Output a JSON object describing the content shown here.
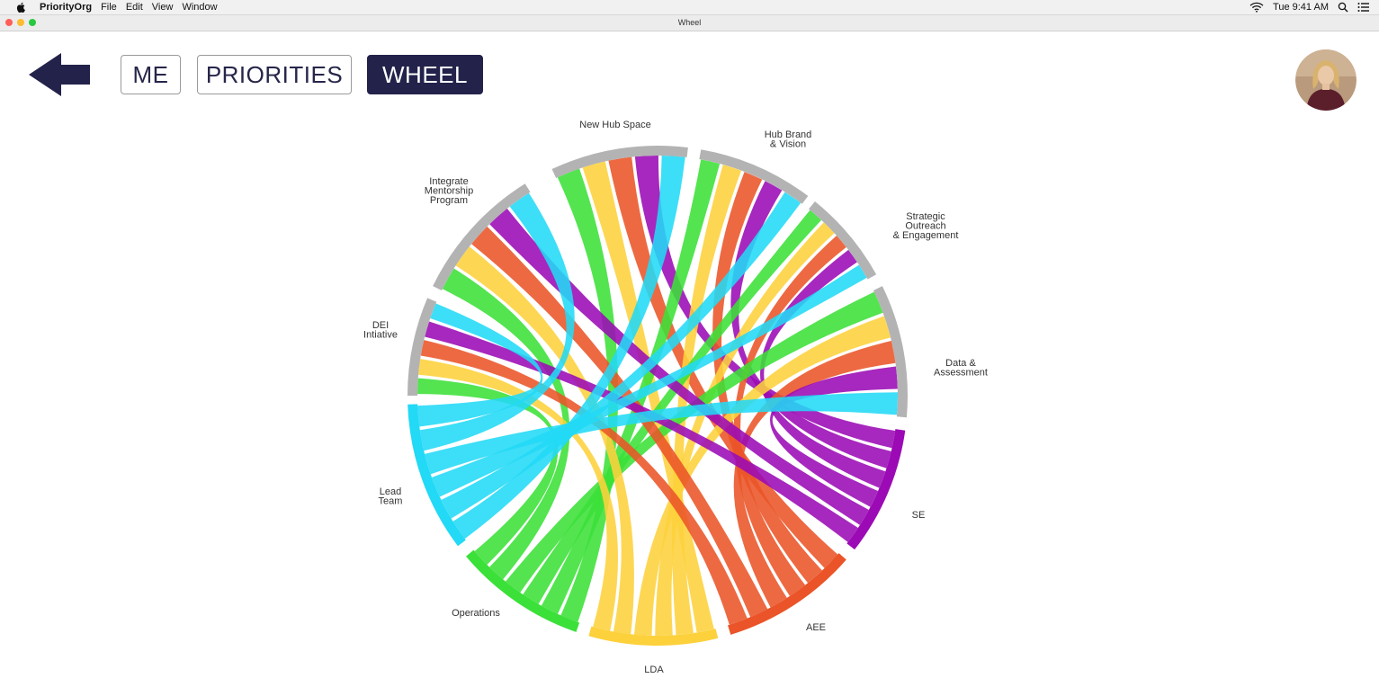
{
  "menubar": {
    "app_name": "PriorityOrg",
    "menus": [
      "File",
      "Edit",
      "View",
      "Window"
    ],
    "clock": "Tue 9:41 AM",
    "icons": [
      "apple-icon",
      "wifi-icon",
      "search-icon",
      "list-icon"
    ]
  },
  "window": {
    "title": "Wheel",
    "traffic_light_colors": [
      "#ff5f57",
      "#febc2e",
      "#28c840"
    ]
  },
  "nav": {
    "back_icon": "back-arrow-icon",
    "tabs": [
      {
        "label": "ME",
        "active": false
      },
      {
        "label": "PRIORITIES",
        "active": false
      },
      {
        "label": "WHEEL",
        "active": true
      }
    ]
  },
  "colors": {
    "accent": "#22224a",
    "arc_gray": "#b3b3b3",
    "cyan": "#22d9f6",
    "green": "#3be038",
    "yellow": "#fdd13b",
    "orange": "#ea5428",
    "purple": "#9b0ab5"
  },
  "wheel": {
    "groups": [
      {
        "id": "new_hub_space",
        "label_lines": [
          "New Hub Space"
        ],
        "color": "arc_gray"
      },
      {
        "id": "hub_brand",
        "label_lines": [
          "Hub Brand",
          "& Vision"
        ],
        "color": "arc_gray"
      },
      {
        "id": "strategic",
        "label_lines": [
          "Strategic",
          "Outreach",
          "& Engagement"
        ],
        "color": "arc_gray"
      },
      {
        "id": "data",
        "label_lines": [
          "Data &",
          "Assessment"
        ],
        "color": "arc_gray"
      },
      {
        "id": "se",
        "label_lines": [
          "SE"
        ],
        "color": "purple"
      },
      {
        "id": "aee",
        "label_lines": [
          "AEE"
        ],
        "color": "orange"
      },
      {
        "id": "lda",
        "label_lines": [
          "LDA"
        ],
        "color": "yellow"
      },
      {
        "id": "operations",
        "label_lines": [
          "Operations"
        ],
        "color": "green"
      },
      {
        "id": "lead_team",
        "label_lines": [
          "Lead",
          "Team"
        ],
        "color": "cyan"
      },
      {
        "id": "dei",
        "label_lines": [
          "DEI",
          "Intiative"
        ],
        "color": "arc_gray"
      },
      {
        "id": "mentorship",
        "label_lines": [
          "Integrate",
          "Mentorship",
          "Program"
        ],
        "color": "arc_gray"
      }
    ],
    "ribbons": [
      {
        "from": "new_hub_space",
        "to": "operations",
        "color": "green"
      },
      {
        "from": "new_hub_space",
        "to": "lda",
        "color": "yellow"
      },
      {
        "from": "new_hub_space",
        "to": "aee",
        "color": "orange"
      },
      {
        "from": "new_hub_space",
        "to": "se",
        "color": "purple"
      },
      {
        "from": "hub_brand",
        "to": "operations",
        "color": "green"
      },
      {
        "from": "hub_brand",
        "to": "lda",
        "color": "yellow"
      },
      {
        "from": "hub_brand",
        "to": "aee",
        "color": "orange"
      },
      {
        "from": "hub_brand",
        "to": "se",
        "color": "purple"
      },
      {
        "from": "strategic",
        "to": "operations",
        "color": "green"
      },
      {
        "from": "strategic",
        "to": "lda",
        "color": "yellow"
      },
      {
        "from": "strategic",
        "to": "aee",
        "color": "orange"
      },
      {
        "from": "strategic",
        "to": "se",
        "color": "purple"
      },
      {
        "from": "data",
        "to": "operations",
        "color": "green"
      },
      {
        "from": "data",
        "to": "lda",
        "color": "yellow"
      },
      {
        "from": "data",
        "to": "aee",
        "color": "orange"
      },
      {
        "from": "data",
        "to": "se",
        "color": "purple"
      },
      {
        "from": "mentorship",
        "to": "operations",
        "color": "green"
      },
      {
        "from": "mentorship",
        "to": "lda",
        "color": "yellow"
      },
      {
        "from": "mentorship",
        "to": "aee",
        "color": "orange"
      },
      {
        "from": "mentorship",
        "to": "se",
        "color": "purple"
      },
      {
        "from": "dei",
        "to": "operations",
        "color": "green"
      },
      {
        "from": "dei",
        "to": "lda",
        "color": "yellow"
      },
      {
        "from": "dei",
        "to": "aee",
        "color": "orange"
      },
      {
        "from": "dei",
        "to": "se",
        "color": "purple"
      },
      {
        "from": "lead_team",
        "to": "new_hub_space",
        "color": "cyan"
      },
      {
        "from": "lead_team",
        "to": "hub_brand",
        "color": "cyan"
      },
      {
        "from": "lead_team",
        "to": "strategic",
        "color": "cyan"
      },
      {
        "from": "lead_team",
        "to": "data",
        "color": "cyan"
      },
      {
        "from": "lead_team",
        "to": "mentorship",
        "color": "cyan"
      },
      {
        "from": "lead_team",
        "to": "dei",
        "color": "cyan"
      }
    ]
  }
}
